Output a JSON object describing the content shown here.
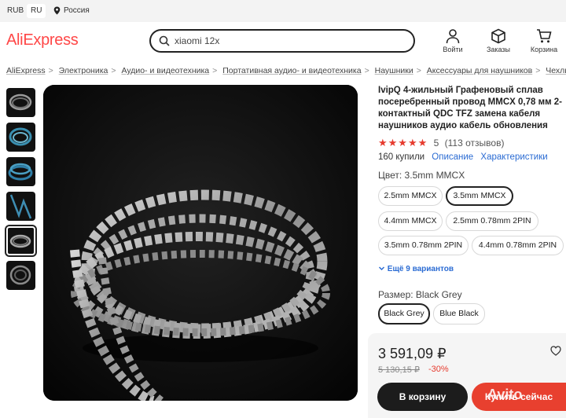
{
  "topbar": {
    "currency": "RUB",
    "language": "RU",
    "location": "Россия"
  },
  "header": {
    "logo": "AliExpress",
    "search_value": "xiaomi 12x",
    "login_label": "Войти",
    "orders_label": "Заказы",
    "cart_label": "Корзина"
  },
  "breadcrumbs": [
    "AliExpress",
    "Электроника",
    "Аудио- и видеотехника",
    "Портативная аудио- и видеотехника",
    "Наушники",
    "Аксессуары для наушников",
    "Чехлы"
  ],
  "product": {
    "title": "IvipQ 4-жильный Графеновый сплав посеребренный провод MMCX 0,78 мм 2-контактный QDC TFZ замена кабеля наушников аудио кабель обновления",
    "stars": "★★★★★",
    "rating": "5",
    "reviews": "(113 отзывов)",
    "sold": "160 купили",
    "tab_description": "Описание",
    "tab_specs": "Характеристики",
    "color_label": "Цвет: 3.5mm MMCX",
    "color_options": [
      "2.5mm MMCX",
      "3.5mm MMCX",
      "4.4mm MMCX",
      "2.5mm 0.78mm 2PIN",
      "3.5mm 0.78mm 2PIN",
      "4.4mm 0.78mm 2PIN"
    ],
    "more_variants": "Ещё 9 вариантов",
    "size_label": "Размер: Black Grey",
    "size_options": [
      "Black Grey",
      "Blue Black"
    ]
  },
  "purchase": {
    "price": "3 591,09 ₽",
    "old_price": "5 130,15 ₽",
    "discount": "-30%",
    "cart_button": "В корзину",
    "buy_button": "Купить сейчас"
  },
  "watermark": "Avito",
  "colors": {
    "brand": "#ff4747",
    "accent_red": "#e8402f",
    "link": "#2a6bd3",
    "dark_button": "#1c1c1c"
  }
}
